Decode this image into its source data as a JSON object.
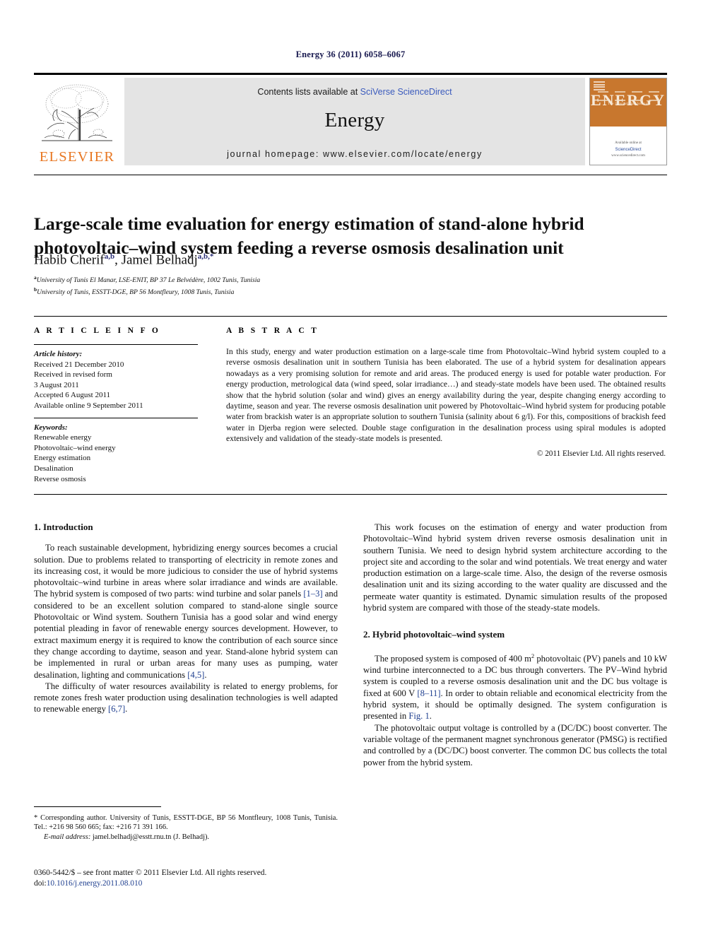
{
  "running_head": "Energy 36 (2011) 6058–6067",
  "masthead": {
    "publisher_name": "ELSEVIER",
    "contents_prefix": "Contents lists available at ",
    "contents_link": "SciVerse ScienceDirect",
    "journal_name": "Energy",
    "homepage": "journal homepage: www.elsevier.com/locate/energy",
    "cover": {
      "title": "ENERGY",
      "subtitle": "The International Journal",
      "footer_text": "Available online at",
      "badge": "ScienceDirect",
      "url": "www.sciencedirect.com",
      "accent_color": "#c8772e"
    },
    "link_color": "#3b5bbd",
    "brand_color": "#E87722"
  },
  "article": {
    "title": "Large-scale time evaluation for energy estimation of stand-alone hybrid photovoltaic–wind system feeding a reverse osmosis desalination unit",
    "authors": [
      {
        "name": "Habib Cherif",
        "marks": "a,b"
      },
      {
        "name": "Jamel Belhadj",
        "marks": "a,b,*"
      }
    ],
    "affiliations": [
      {
        "mark": "a",
        "text": "University of Tunis El Manar, LSE-ENIT, BP 37 Le Belvédère, 1002 Tunis, Tunisia"
      },
      {
        "mark": "b",
        "text": "University of Tunis, ESSTT-DGE, BP 56 Montfleury, 1008 Tunis, Tunisia"
      }
    ]
  },
  "article_info": {
    "heading": "A R T I C L E  I N F O",
    "history_label": "Article history:",
    "history": [
      "Received 21 December 2010",
      "Received in revised form",
      "3 August 2011",
      "Accepted 6 August 2011",
      "Available online 9 September 2011"
    ],
    "keywords_label": "Keywords:",
    "keywords": [
      "Renewable energy",
      "Photovoltaic–wind energy",
      "Energy estimation",
      "Desalination",
      "Reverse osmosis"
    ]
  },
  "abstract": {
    "heading": "A B S T R A C T",
    "text": "In this study, energy and water production estimation on a large-scale time from Photovoltaic–Wind hybrid system coupled to a reverse osmosis desalination unit in southern Tunisia has been elaborated. The use of a hybrid system for desalination appears nowadays as a very promising solution for remote and arid areas. The produced energy is used for potable water production. For energy production, metrological data (wind speed, solar irradiance…) and steady-state models have been used. The obtained results show that the hybrid solution (solar and wind) gives an energy availability during the year, despite changing energy according to daytime, season and year. The reverse osmosis desalination unit powered by Photovoltaic–Wind hybrid system for producing potable water from brackish water is an appropriate solution to southern Tunisia (salinity about 6 g/l). For this, compositions of brackish feed water in Djerba region were selected. Double stage configuration in the desalination process using spiral modules is adopted extensively and validation of the steady-state models is presented.",
    "copyright": "© 2011 Elsevier Ltd. All rights reserved."
  },
  "body": {
    "section1_heading": "1. Introduction",
    "p1_a": "To reach sustainable development, hybridizing energy sources becomes a crucial solution. Due to problems related to transporting of electricity in remote zones and its increasing cost, it would be more judicious to consider the use of hybrid systems photovoltaic–wind turbine in areas where solar irradiance and winds are available. The hybrid system is composed of two parts: wind turbine and solar panels ",
    "p1_ref1": "[1–3]",
    "p1_b": " and considered to be an excellent solution compared to stand-alone single source Photovoltaic or Wind system. Southern Tunisia has a good solar and wind energy potential pleading in favor of renewable energy sources development. However, to extract maximum energy it is required to know the contribution of each source since they change according to daytime, season and year. Stand-alone hybrid system can be implemented in rural or urban areas for many uses as pumping, water desalination, lighting and communications ",
    "p1_ref2": "[4,5]",
    "p1_c": ".",
    "p2_a": "The difficulty of water resources availability is related to energy problems, for remote zones fresh water production using desalination technologies is well adapted to renewable energy ",
    "p2_ref": "[6,7]",
    "p2_b": ".",
    "p3": "This work focuses on the estimation of energy and water production from Photovoltaic–Wind hybrid system driven reverse osmosis desalination unit in southern Tunisia. We need to design hybrid system architecture according to the project site and according to the solar and wind potentials. We treat energy and water production estimation on a large-scale time. Also, the design of the reverse osmosis desalination unit and its sizing according to the water quality are discussed and the permeate water quantity is estimated. Dynamic simulation results of the proposed hybrid system are compared with those of the steady-state models.",
    "section2_heading": "2. Hybrid photovoltaic–wind system",
    "p4_a": "The proposed system is composed of 400 m",
    "p4_sup": "2",
    "p4_b": " photovoltaic (PV) panels and 10 kW wind turbine interconnected to a DC bus through converters. The PV–Wind hybrid system is coupled to a reverse osmosis desalination unit and the DC bus voltage is fixed at 600 V ",
    "p4_ref1": "[8–11]",
    "p4_c": ". In order to obtain reliable and economical electricity from the hybrid system, it should be optimally designed. The system configuration is presented in ",
    "p4_ref2": "Fig. 1",
    "p4_d": ".",
    "p5": "The photovoltaic output voltage is controlled by a (DC/DC) boost converter. The variable voltage of the permanent magnet synchronous generator (PMSG) is rectified and controlled by a (DC/DC) boost converter. The common DC bus collects the total power from the hybrid system."
  },
  "footer": {
    "corresponding_mark": "*",
    "corresponding": "Corresponding author. University of Tunis, ESSTT-DGE, BP 56 Montfleury, 1008 Tunis, Tunisia. Tel.: +216 98 560 665; fax: +216 71 391 166.",
    "email_label": "E-mail address:",
    "email": "jamel.belhadj@esstt.rnu.tn",
    "email_suffix": "(J. Belhadj).",
    "issn_line": "0360-5442/$ – see front matter © 2011 Elsevier Ltd. All rights reserved.",
    "doi_label": "doi:",
    "doi": "10.1016/j.energy.2011.08.010"
  }
}
